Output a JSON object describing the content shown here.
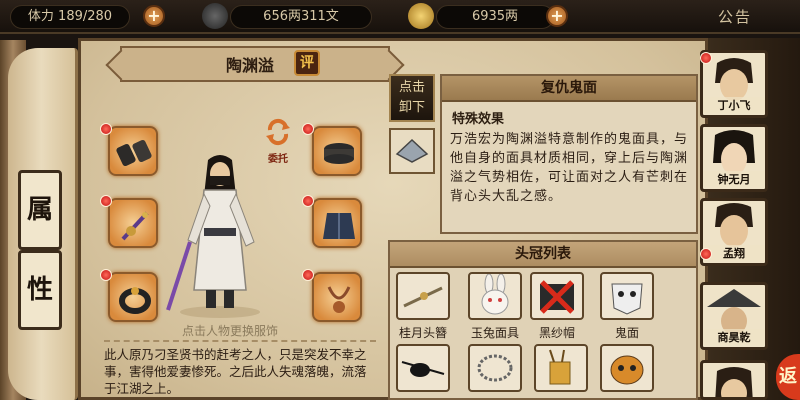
{
  "topbar": {
    "stamina": "体力 189/280",
    "coins": "656两311文",
    "gold": "6935两",
    "announce": "公告"
  },
  "left_tabs": [
    "属",
    "性"
  ],
  "hero": {
    "name": "陶渊溢",
    "rate_label": "评",
    "entrust_label": "委托",
    "hint": "点击人物更换服饰",
    "bio": "此人原乃刁圣贤书的赶考之人，只是突发不幸之事，害得他爱妻惨死。之后此人失魂落魄，流落于江湖之上。"
  },
  "unload_button": "点击\n卸下",
  "detail": {
    "title": "复仇鬼面",
    "section": "特殊效果",
    "description": "万浩宏为陶渊溢特意制作的鬼面具，与他自身的面具材质相同，穿上后与陶渊溢之气势相佐，可让面对之人有芒刺在背心头大乱之感。"
  },
  "headwear_list": {
    "title": "头冠列表",
    "items": [
      {
        "label": "桂月头簪",
        "icon": "hairpin-icon"
      },
      {
        "label": "玉兔面具",
        "icon": "rabbit-mask-icon"
      },
      {
        "label": "黑纱帽",
        "icon": "black-hat-icon"
      },
      {
        "label": "鬼面",
        "icon": "ghost-mask-icon"
      },
      {
        "label": "",
        "icon": "eyepatch-icon"
      },
      {
        "label": "",
        "icon": "bead-necklace-icon"
      },
      {
        "label": "",
        "icon": "quiver-icon"
      },
      {
        "label": "",
        "icon": "tiger-mask-icon"
      }
    ]
  },
  "side_heroes": [
    {
      "name": "丁小飞"
    },
    {
      "name": "钟无月"
    },
    {
      "name": "孟翔"
    },
    {
      "name": "商昊乾"
    },
    {
      "name": ""
    }
  ],
  "colors": {
    "accent": "#d98a3c",
    "parchment": "#d9c8a5",
    "notice_red": "#c01010"
  }
}
